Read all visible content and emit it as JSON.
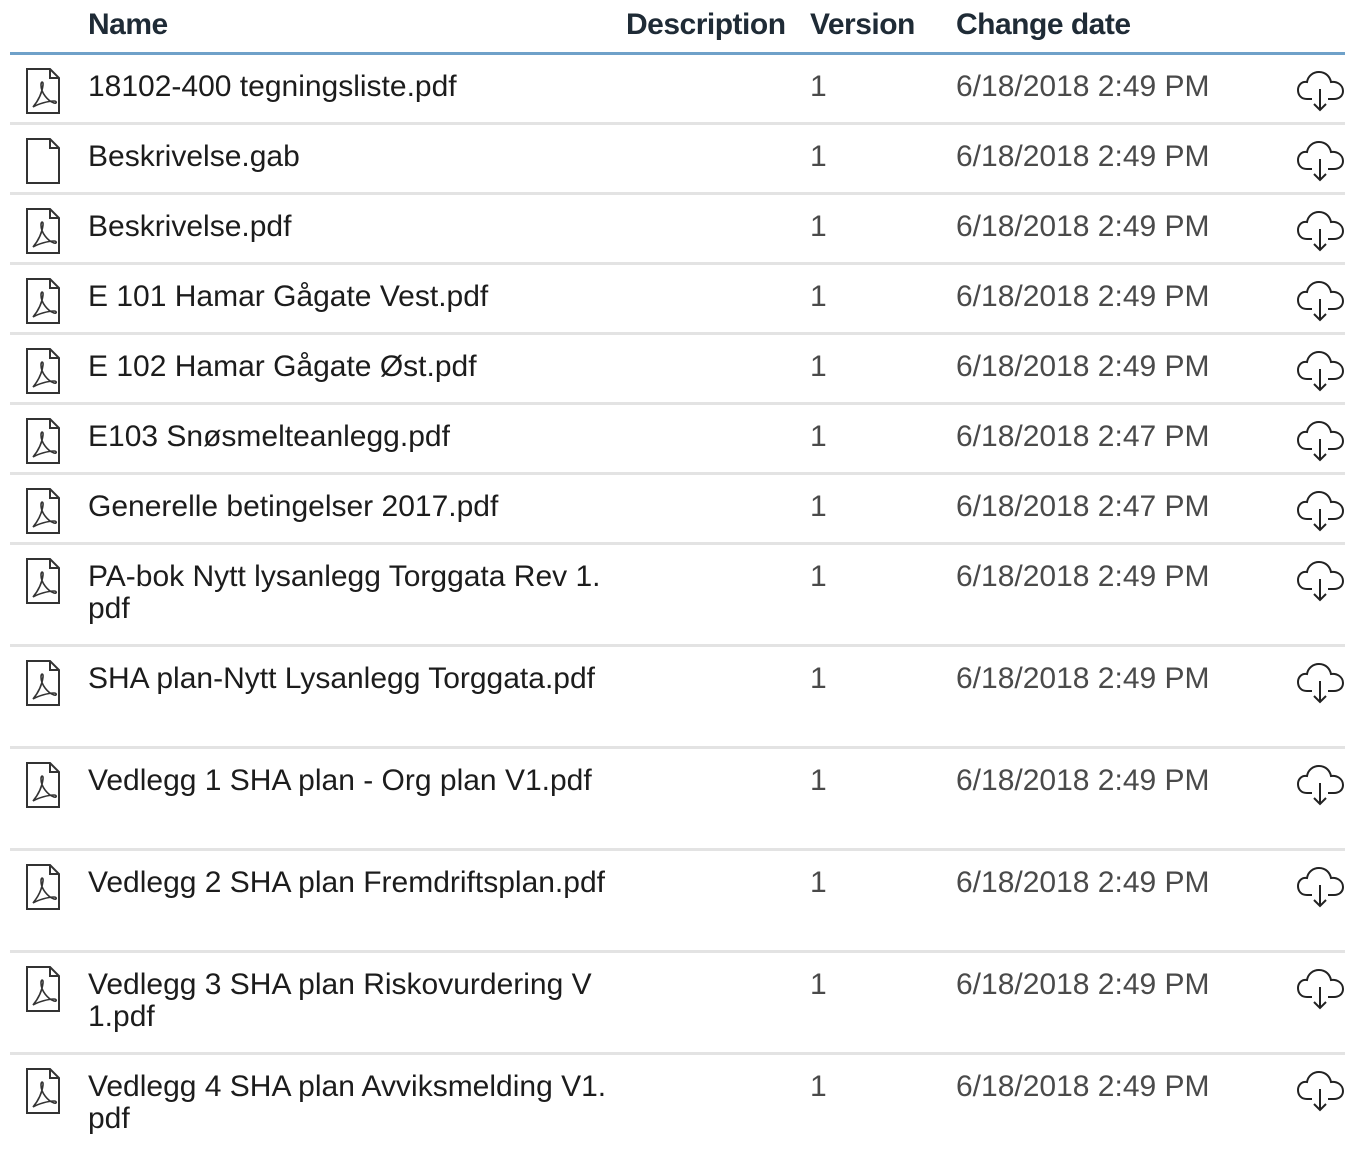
{
  "header": {
    "name": "Name",
    "description": "Description",
    "version": "Version",
    "change_date": "Change date"
  },
  "files": [
    {
      "name": "18102-400 tegningsliste.pdf",
      "description": "",
      "version": "1",
      "date": "6/18/2018 2:49 PM",
      "icon": "pdf-file-icon"
    },
    {
      "name": "Beskrivelse.gab",
      "description": "",
      "version": "1",
      "date": "6/18/2018 2:49 PM",
      "icon": "generic-file-icon"
    },
    {
      "name": "Beskrivelse.pdf",
      "description": "",
      "version": "1",
      "date": "6/18/2018 2:49 PM",
      "icon": "pdf-file-icon"
    },
    {
      "name": "E 101 Hamar Gågate Vest.pdf",
      "description": "",
      "version": "1",
      "date": "6/18/2018 2:49 PM",
      "icon": "pdf-file-icon"
    },
    {
      "name": "E 102 Hamar Gågate Øst.pdf",
      "description": "",
      "version": "1",
      "date": "6/18/2018 2:49 PM",
      "icon": "pdf-file-icon"
    },
    {
      "name": "E103 Snøsmelteanlegg.pdf",
      "description": "",
      "version": "1",
      "date": "6/18/2018 2:47 PM",
      "icon": "pdf-file-icon"
    },
    {
      "name": "Generelle betingelser 2017.pdf",
      "description": "",
      "version": "1",
      "date": "6/18/2018 2:47 PM",
      "icon": "pdf-file-icon"
    },
    {
      "name": "PA-bok Nytt lysanlegg Torggata Rev 1.pdf",
      "description": "",
      "version": "1",
      "date": "6/18/2018 2:49 PM",
      "icon": "pdf-file-icon"
    },
    {
      "name": "SHA plan-Nytt Lysanlegg Torggata.pdf",
      "description": "",
      "version": "1",
      "date": "6/18/2018 2:49 PM",
      "icon": "pdf-file-icon"
    },
    {
      "name": "Vedlegg 1 SHA plan - Org plan V1.pdf",
      "description": "",
      "version": "1",
      "date": "6/18/2018 2:49 PM",
      "icon": "pdf-file-icon"
    },
    {
      "name": "Vedlegg 2 SHA plan Fremdriftsplan.pdf",
      "description": "",
      "version": "1",
      "date": "6/18/2018 2:49 PM",
      "icon": "pdf-file-icon"
    },
    {
      "name": "Vedlegg 3 SHA plan Riskovurdering V1.pdf",
      "description": "",
      "version": "1",
      "date": "6/18/2018 2:49 PM",
      "icon": "pdf-file-icon"
    },
    {
      "name": "Vedlegg 4 SHA plan Avviksmelding V1.pdf",
      "description": "",
      "version": "1",
      "date": "6/18/2018 2:49 PM",
      "icon": "pdf-file-icon"
    }
  ],
  "actions": {
    "download_icon": "cloud-download-icon"
  },
  "colors": {
    "header_rule": "#6fa1c9",
    "row_divider": "#e3e3e3"
  }
}
